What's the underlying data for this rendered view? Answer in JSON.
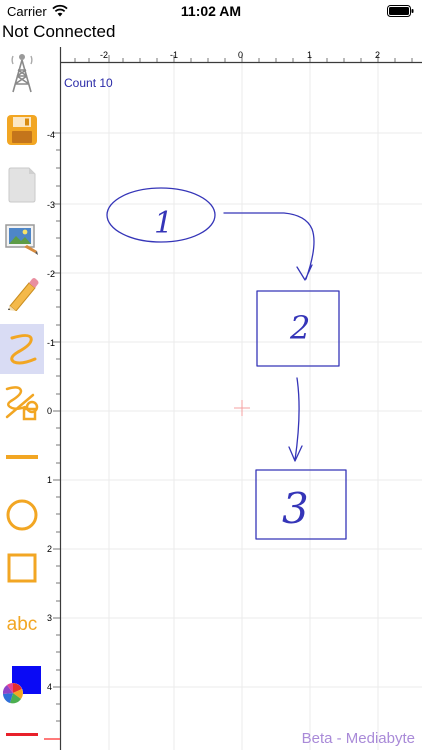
{
  "status_bar": {
    "carrier": "Carrier",
    "time": "11:02 AM"
  },
  "connection_status": "Not Connected",
  "toolbar": {
    "tools": [
      {
        "name": "connection-tower-icon"
      },
      {
        "name": "save-icon"
      },
      {
        "name": "blank-page-icon"
      },
      {
        "name": "image-icon"
      },
      {
        "name": "pencil-icon"
      },
      {
        "name": "freehand-icon",
        "selected": true
      },
      {
        "name": "freehand-shape-icon"
      },
      {
        "name": "line-icon"
      },
      {
        "name": "circle-icon"
      },
      {
        "name": "square-icon"
      },
      {
        "name": "text-tool",
        "label": "abc"
      },
      {
        "name": "color-picker-icon"
      },
      {
        "name": "line-color-icon"
      }
    ]
  },
  "canvas": {
    "count_label": "Count 10",
    "x_ruler_labels": [
      "-2",
      "-1",
      "0",
      "1",
      "2"
    ],
    "y_ruler_labels": [
      "-4",
      "-3",
      "-2",
      "-1",
      "0",
      "1",
      "2",
      "3",
      "4"
    ],
    "diagram_labels": [
      "1",
      "2",
      "3"
    ],
    "footer_text": "Beta - Mediabyte"
  },
  "colors": {
    "ink": "#3535b8",
    "tool_accent": "#f2a623",
    "selected_bg": "#d9dcf4",
    "grid": "#ebebeb",
    "brand": "#a98ad8",
    "line_color": "#e8202a"
  }
}
